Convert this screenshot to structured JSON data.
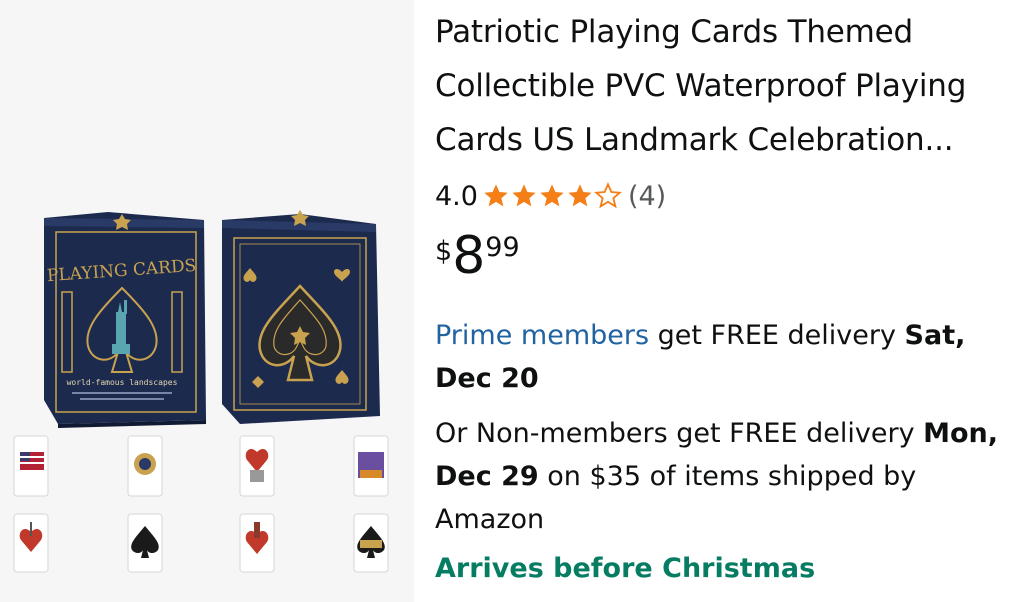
{
  "product": {
    "title": "Patriotic Playing Cards Themed Collectible PVC Waterproof Playing Cards US Landmark Celebration...",
    "image": {
      "front_box_text": "PLAYING CARDS",
      "front_box_subtext": "world-famous landscapes",
      "thumbnails": [
        "flag-card",
        "eagle-seal-card",
        "liberty-bell-card",
        "landmark-card",
        "heart-monument-card",
        "spade-landmark-card",
        "heart-tower-card",
        "spade-city-card"
      ]
    },
    "rating": {
      "value": "4.0",
      "stars": 4,
      "max_stars": 5,
      "count": "(4)"
    },
    "price": {
      "symbol": "$",
      "whole": "8",
      "fraction": "99"
    },
    "delivery_prime": {
      "link": "Prime members",
      "text": " get FREE delivery ",
      "date": "Sat, Dec 20"
    },
    "delivery_nonmember": {
      "prefix": "Or Non-members get FREE delivery ",
      "date": "Mon, Dec 29",
      "suffix": " on $35 of items shipped by Amazon"
    },
    "arrives": "Arrives before Christmas"
  },
  "colors": {
    "star": "#f57f17",
    "prime_link": "#2162a1",
    "arrives": "#067d62",
    "box_navy": "#1c2a4e",
    "gold": "#c9a24f"
  }
}
